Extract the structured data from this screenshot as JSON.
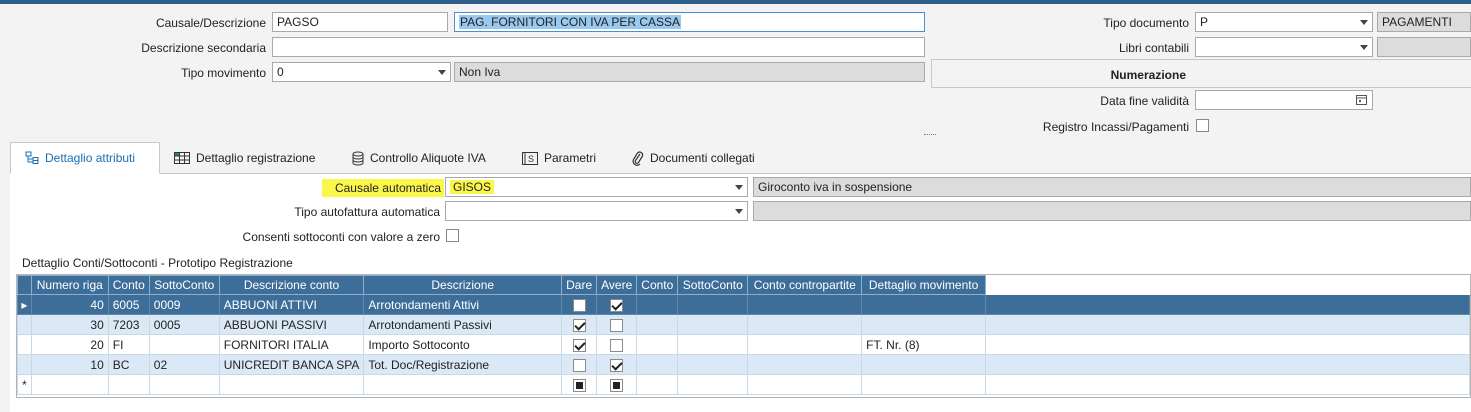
{
  "header": {
    "causale_label": "Causale/Descrizione",
    "causale_code": "PAGSO",
    "causale_desc": "PAG. FORNITORI CON IVA PER CASSA",
    "desc_secondaria_label": "Descrizione secondaria",
    "desc_secondaria_value": "",
    "tipo_movimento_label": "Tipo movimento",
    "tipo_movimento_value": "0",
    "tipo_movimento_desc": "Non Iva",
    "tipo_documento_label": "Tipo documento",
    "tipo_documento_value": "P",
    "tipo_documento_desc": "PAGAMENTI",
    "libri_contabili_label": "Libri contabili",
    "libri_contabili_value": "",
    "numerazione_label": "Numerazione",
    "data_fine_label": "Data fine validità",
    "data_fine_value": "",
    "registro_label": "Registro Incassi/Pagamenti"
  },
  "tabs": [
    {
      "label": "Dettaglio attributi",
      "icon": "list-tree-icon",
      "active": true
    },
    {
      "label": "Dettaglio registrazione",
      "icon": "grid-icon",
      "active": false
    },
    {
      "label": "Controllo Aliquote IVA",
      "icon": "coins-icon",
      "active": false
    },
    {
      "label": "Parametri",
      "icon": "parameters-icon",
      "active": false
    },
    {
      "label": "Documenti collegati",
      "icon": "paperclip-icon",
      "active": false
    }
  ],
  "attributi": {
    "causale_automatica_label": "Causale automatica",
    "causale_automatica_value": "GISOS",
    "causale_automatica_desc": "Giroconto iva in sospensione",
    "tipo_autofattura_label": "Tipo autofattura automatica",
    "tipo_autofattura_value": "",
    "consenti_label": "Consenti sottoconti con valore a zero"
  },
  "grid": {
    "section_title": "Dettaglio Conti/Sottoconti - Prototipo Registrazione",
    "columns": [
      "Numero riga",
      "Conto",
      "SottoConto",
      "Descrizione conto",
      "Descrizione",
      "Dare",
      "Avere",
      "Conto",
      "SottoConto",
      "Conto contropartite",
      "Dettaglio movimento"
    ],
    "rows": [
      {
        "numero": "40",
        "conto": "6005",
        "sottoconto": "0009",
        "desc_conto": "ABBUONI ATTIVI",
        "descrizione": "Arrotondamenti Attivi",
        "dare": false,
        "avere": true,
        "conto2": "",
        "sottoconto2": "",
        "contropartite": "",
        "dettaglio": ""
      },
      {
        "numero": "30",
        "conto": "7203",
        "sottoconto": "0005",
        "desc_conto": "ABBUONI PASSIVI",
        "descrizione": "Arrotondamenti Passivi",
        "dare": true,
        "avere": false,
        "conto2": "",
        "sottoconto2": "",
        "contropartite": "",
        "dettaglio": ""
      },
      {
        "numero": "20",
        "conto": "FI",
        "sottoconto": "",
        "desc_conto": "FORNITORI ITALIA",
        "descrizione": "Importo Sottoconto",
        "dare": true,
        "avere": false,
        "conto2": "",
        "sottoconto2": "",
        "contropartite": "",
        "dettaglio": "FT. Nr. (8)"
      },
      {
        "numero": "10",
        "conto": "BC",
        "sottoconto": "02",
        "desc_conto": "UNICREDIT BANCA  SPA",
        "descrizione": "Tot. Doc/Registrazione",
        "dare": false,
        "avere": true,
        "conto2": "",
        "sottoconto2": "",
        "contropartite": "",
        "dettaglio": ""
      }
    ],
    "new_row_marker": "*"
  }
}
